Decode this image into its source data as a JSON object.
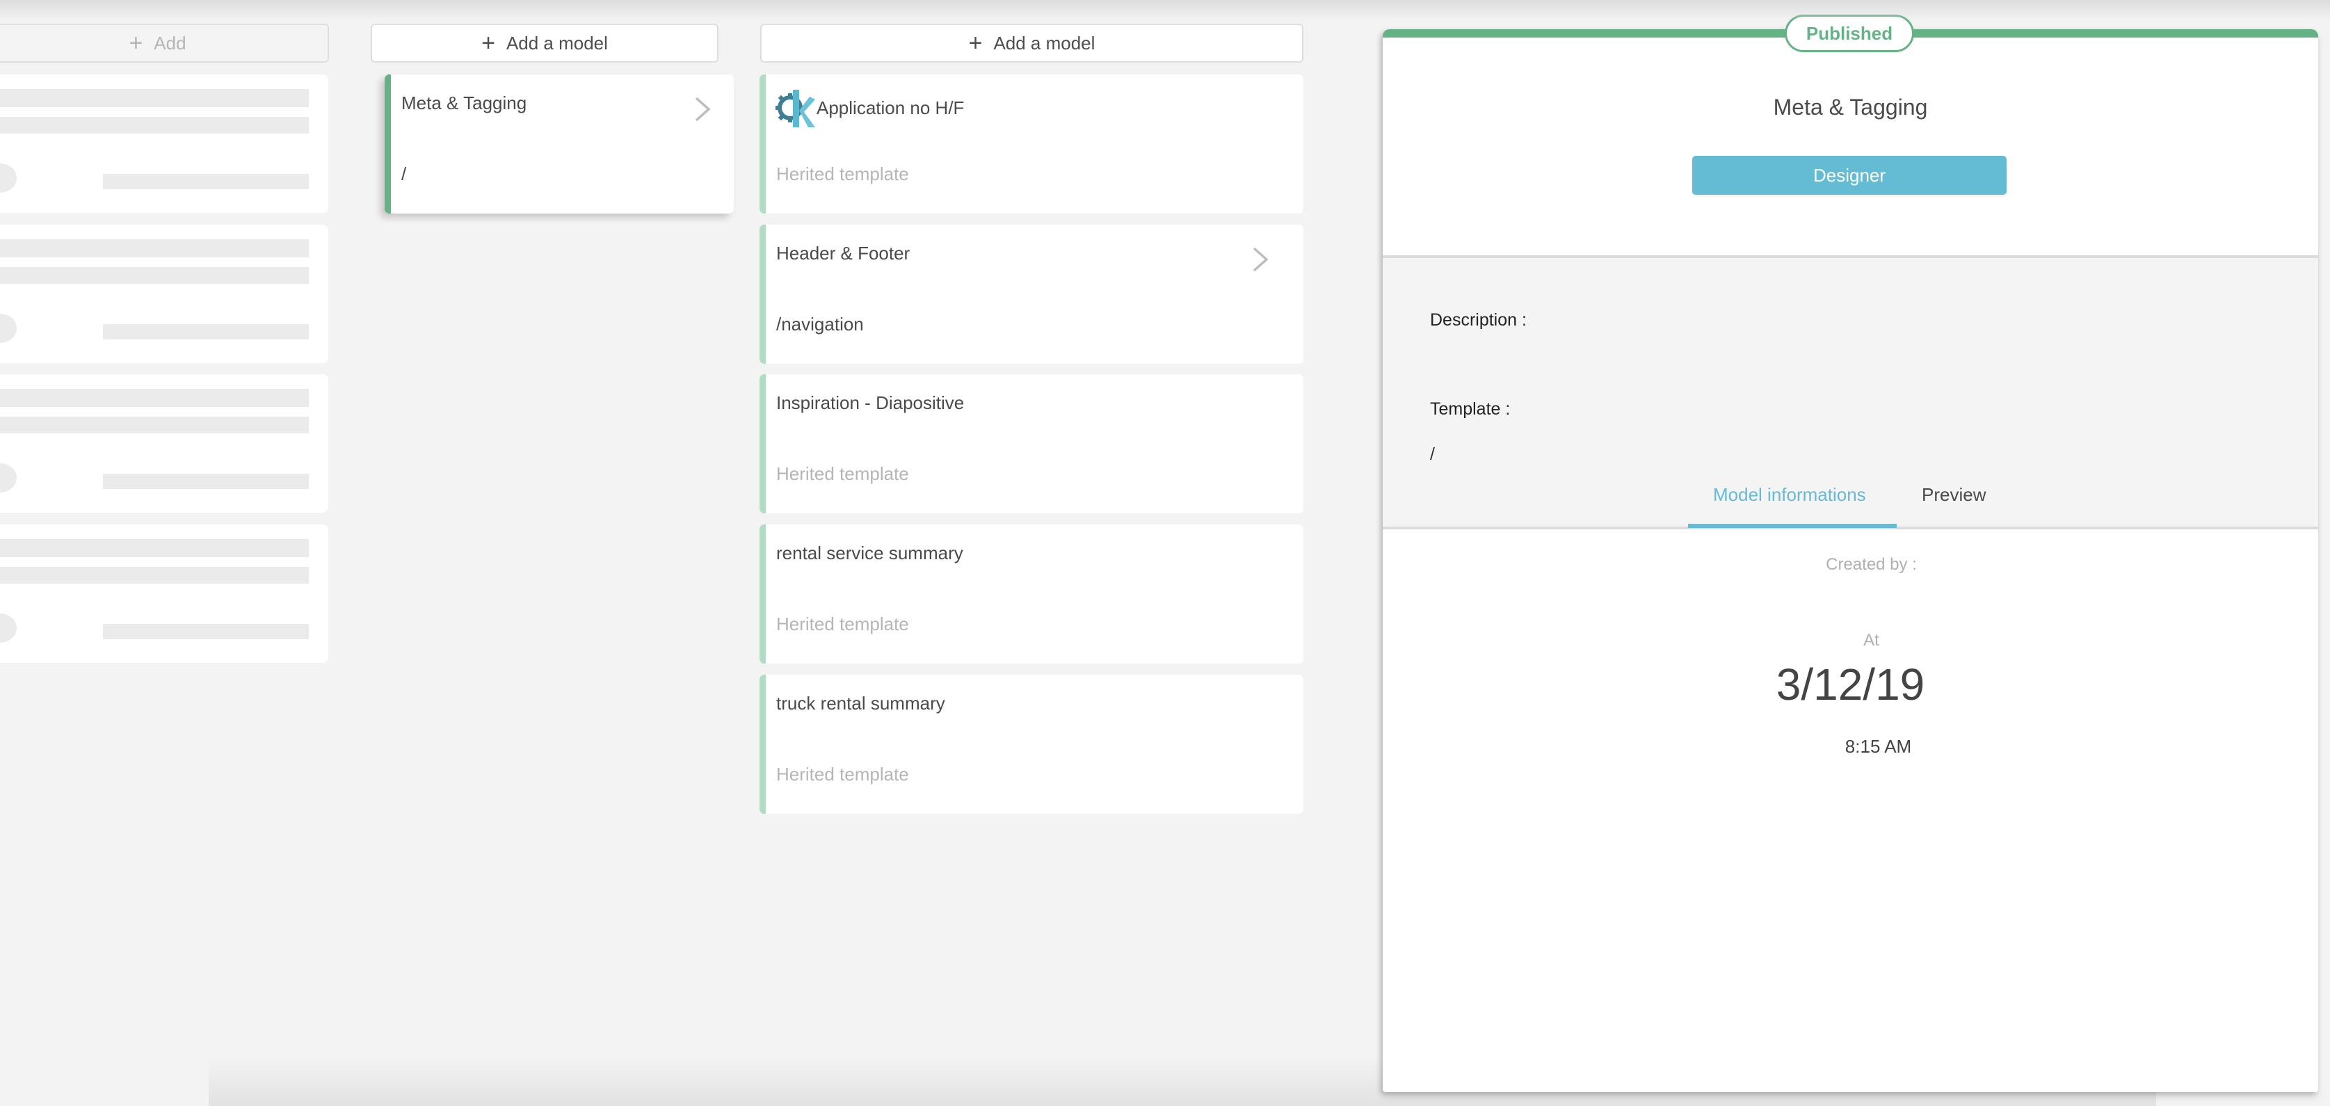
{
  "columns": {
    "col1": {
      "add_label": "Add",
      "add_icon": "plus-icon",
      "skeleton_cards": 4
    },
    "col2": {
      "add_label": "Add  a model",
      "add_icon": "plus-icon",
      "cards": [
        {
          "title": "Meta & Tagging",
          "subtitle": "/",
          "selected": true,
          "has_chevron": true
        }
      ]
    },
    "col3": {
      "add_label": "Add  a model",
      "add_icon": "plus-icon",
      "cards": [
        {
          "title": "Application no H/F",
          "subtitle": "Herited template",
          "icon": "gear-k-logo-icon"
        },
        {
          "title": "Header & Footer",
          "subtitle": "/navigation",
          "has_chevron": true
        },
        {
          "title": "Inspiration - Diapositive",
          "subtitle": "Herited template"
        },
        {
          "title": "rental service summary",
          "subtitle": "Herited template"
        },
        {
          "title": "truck rental summary",
          "subtitle": "Herited template"
        }
      ]
    }
  },
  "detail": {
    "status_badge": "Published",
    "title": "Meta & Tagging",
    "designer_button": "Designer",
    "description_label": "Description :",
    "description_value": "",
    "template_label": "Template :",
    "template_value": "/",
    "tabs": [
      {
        "label": "Model informations",
        "active": true
      },
      {
        "label": "Preview",
        "active": false
      }
    ],
    "created_by_label": "Created by :",
    "created_by_value": "",
    "at_label": "At",
    "date": "3/12/19",
    "time": "8:15 AM"
  },
  "colors": {
    "published_green": "#64b286",
    "card_border_light": "#b2dcc5",
    "accent_blue": "#64bcd4",
    "background": "#f3f3f3"
  }
}
